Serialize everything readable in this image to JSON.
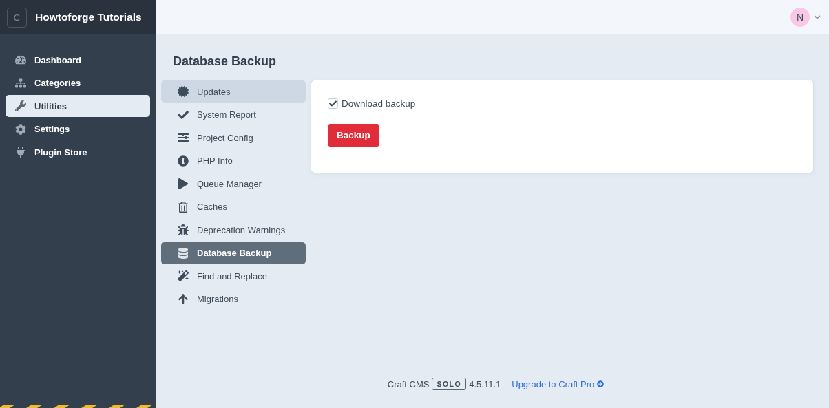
{
  "site": {
    "logo_letter": "C",
    "name": "Howtoforge Tutorials"
  },
  "nav": [
    {
      "label": "Dashboard",
      "selected": false
    },
    {
      "label": "Categories",
      "selected": false
    },
    {
      "label": "Utilities",
      "selected": true
    },
    {
      "label": "Settings",
      "selected": false
    },
    {
      "label": "Plugin Store",
      "selected": false
    }
  ],
  "user": {
    "initial": "N"
  },
  "page_title": "Database Backup",
  "utilities": [
    {
      "label": "Updates",
      "selected": false,
      "hovered": true
    },
    {
      "label": "System Report",
      "selected": false,
      "hovered": false
    },
    {
      "label": "Project Config",
      "selected": false,
      "hovered": false
    },
    {
      "label": "PHP Info",
      "selected": false,
      "hovered": false
    },
    {
      "label": "Queue Manager",
      "selected": false,
      "hovered": false
    },
    {
      "label": "Caches",
      "selected": false,
      "hovered": false
    },
    {
      "label": "Deprecation Warnings",
      "selected": false,
      "hovered": false
    },
    {
      "label": "Database Backup",
      "selected": true,
      "hovered": false
    },
    {
      "label": "Find and Replace",
      "selected": false,
      "hovered": false
    },
    {
      "label": "Migrations",
      "selected": false,
      "hovered": false
    }
  ],
  "backup": {
    "download": {
      "label": "Download backup",
      "checked": true
    },
    "button": "Backup"
  },
  "footer": {
    "product": "Craft CMS",
    "edition": "SOLO",
    "version": "4.5.11.1",
    "upgrade_link": "Upgrade to Craft Pro"
  }
}
